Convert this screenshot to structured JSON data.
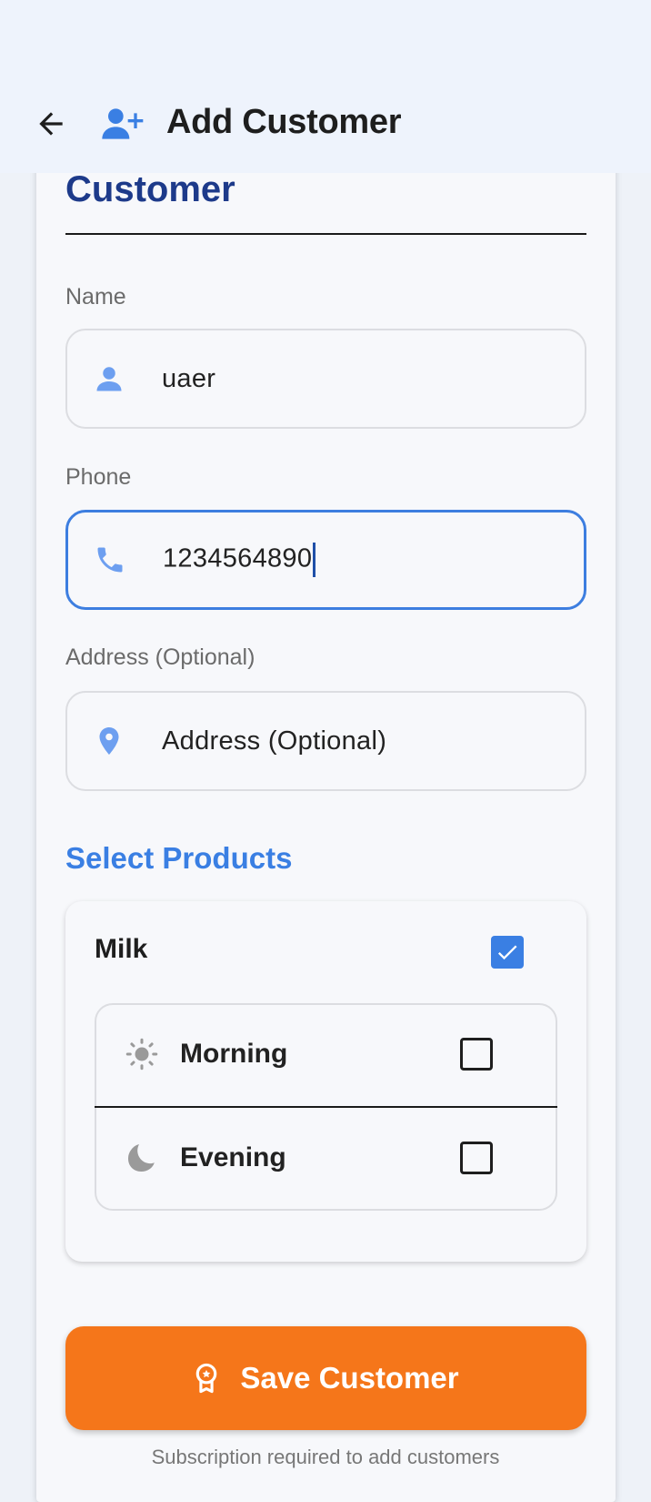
{
  "header": {
    "title": "Add Customer",
    "back_icon": "arrow-back-icon",
    "title_icon": "person-add-icon"
  },
  "form": {
    "section_title": "Customer",
    "name": {
      "label": "Name",
      "value": "uaer",
      "icon": "person-icon"
    },
    "phone": {
      "label": "Phone",
      "value": "1234564890",
      "icon": "phone-icon",
      "focused": true
    },
    "address": {
      "label": "Address (Optional)",
      "placeholder": "Address (Optional)",
      "value": "",
      "icon": "location-pin-icon"
    }
  },
  "products": {
    "section_title": "Select Products",
    "items": [
      {
        "name": "Milk",
        "checked": true,
        "slots": [
          {
            "label": "Morning",
            "icon": "sun-icon",
            "checked": false
          },
          {
            "label": "Evening",
            "icon": "moon-icon",
            "checked": false
          }
        ]
      }
    ]
  },
  "actions": {
    "save_label": "Save Customer",
    "save_icon": "badge-icon"
  },
  "footer_note": "Subscription required to add customers",
  "colors": {
    "accent": "#3a7fe3",
    "title_blue": "#1d3a8a",
    "save_orange": "#f5761a",
    "background": "#f7f8fb"
  }
}
